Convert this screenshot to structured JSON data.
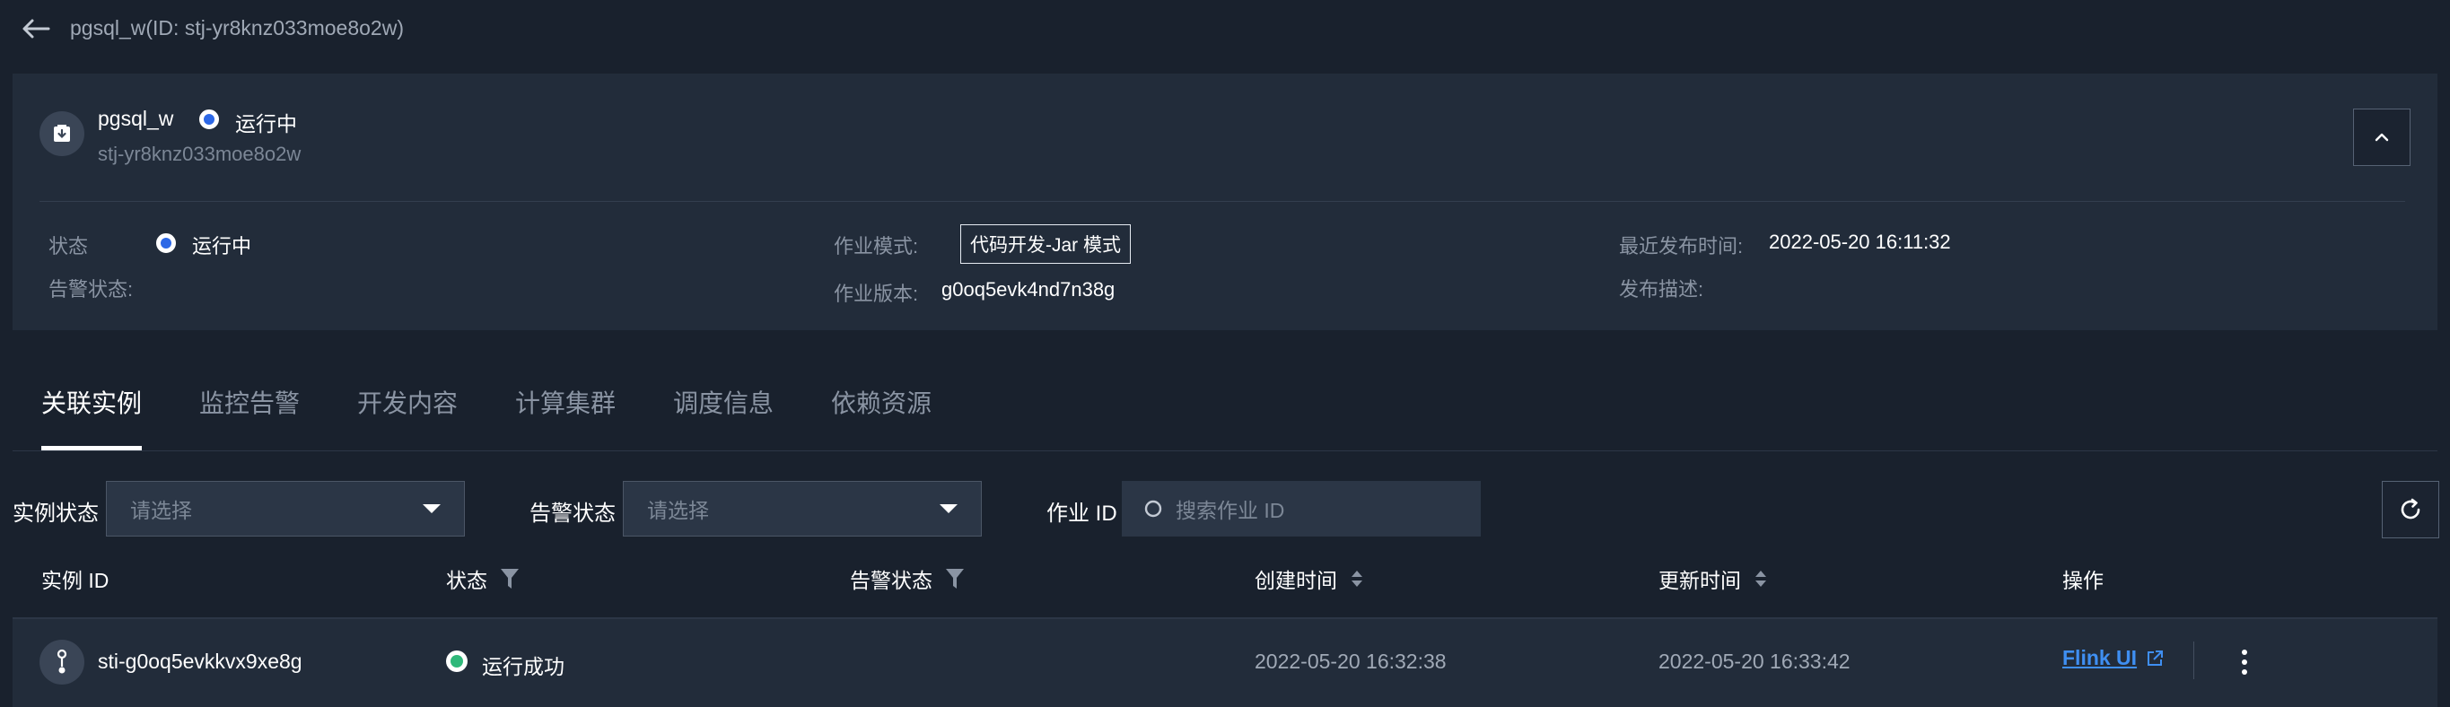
{
  "breadcrumb": {
    "title": "pgsql_w(ID: stj-yr8knz033moe8o2w)"
  },
  "job": {
    "name": "pgsql_w",
    "status": "运行中",
    "id": "stj-yr8knz033moe8o2w"
  },
  "details": {
    "status_label": "状态",
    "status_value": "运行中",
    "alarm_label": "告警状态:",
    "mode_label": "作业模式:",
    "mode_value": "代码开发-Jar 模式",
    "version_label": "作业版本:",
    "version_value": "g0oq5evk4nd7n38g",
    "publish_time_label": "最近发布时间:",
    "publish_time_value": "2022-05-20 16:11:32",
    "publish_desc_label": "发布描述:"
  },
  "tabs": [
    {
      "label": "关联实例"
    },
    {
      "label": "监控告警"
    },
    {
      "label": "开发内容"
    },
    {
      "label": "计算集群"
    },
    {
      "label": "调度信息"
    },
    {
      "label": "依赖资源"
    }
  ],
  "filters": {
    "instance_status_label": "实例状态",
    "instance_status_placeholder": "请选择",
    "alarm_status_label": "告警状态",
    "alarm_status_placeholder": "请选择",
    "job_id_label": "作业 ID",
    "search_placeholder": "搜索作业 ID"
  },
  "table": {
    "columns": [
      "实例 ID",
      "状态",
      "告警状态",
      "创建时间",
      "更新时间",
      "操作"
    ],
    "rows": [
      {
        "instance_id": "sti-g0oq5evkkvx9xe8g",
        "status": "运行成功",
        "alarm_status": "",
        "created": "2022-05-20 16:32:38",
        "updated": "2022-05-20 16:33:42",
        "action": "Flink UI"
      }
    ]
  },
  "colors": {
    "background": "#19212d",
    "card": "#222c3a",
    "accent_blue": "#2d68e6",
    "link": "#3f8ff2",
    "success": "#2fb87a"
  },
  "icons": [
    "back-arrow-icon",
    "job-icon",
    "chevron-up-icon",
    "caret-down-icon",
    "search-icon",
    "refresh-icon",
    "filter-icon",
    "sort-icon",
    "instance-icon",
    "external-link-icon",
    "more-vertical-icon"
  ]
}
